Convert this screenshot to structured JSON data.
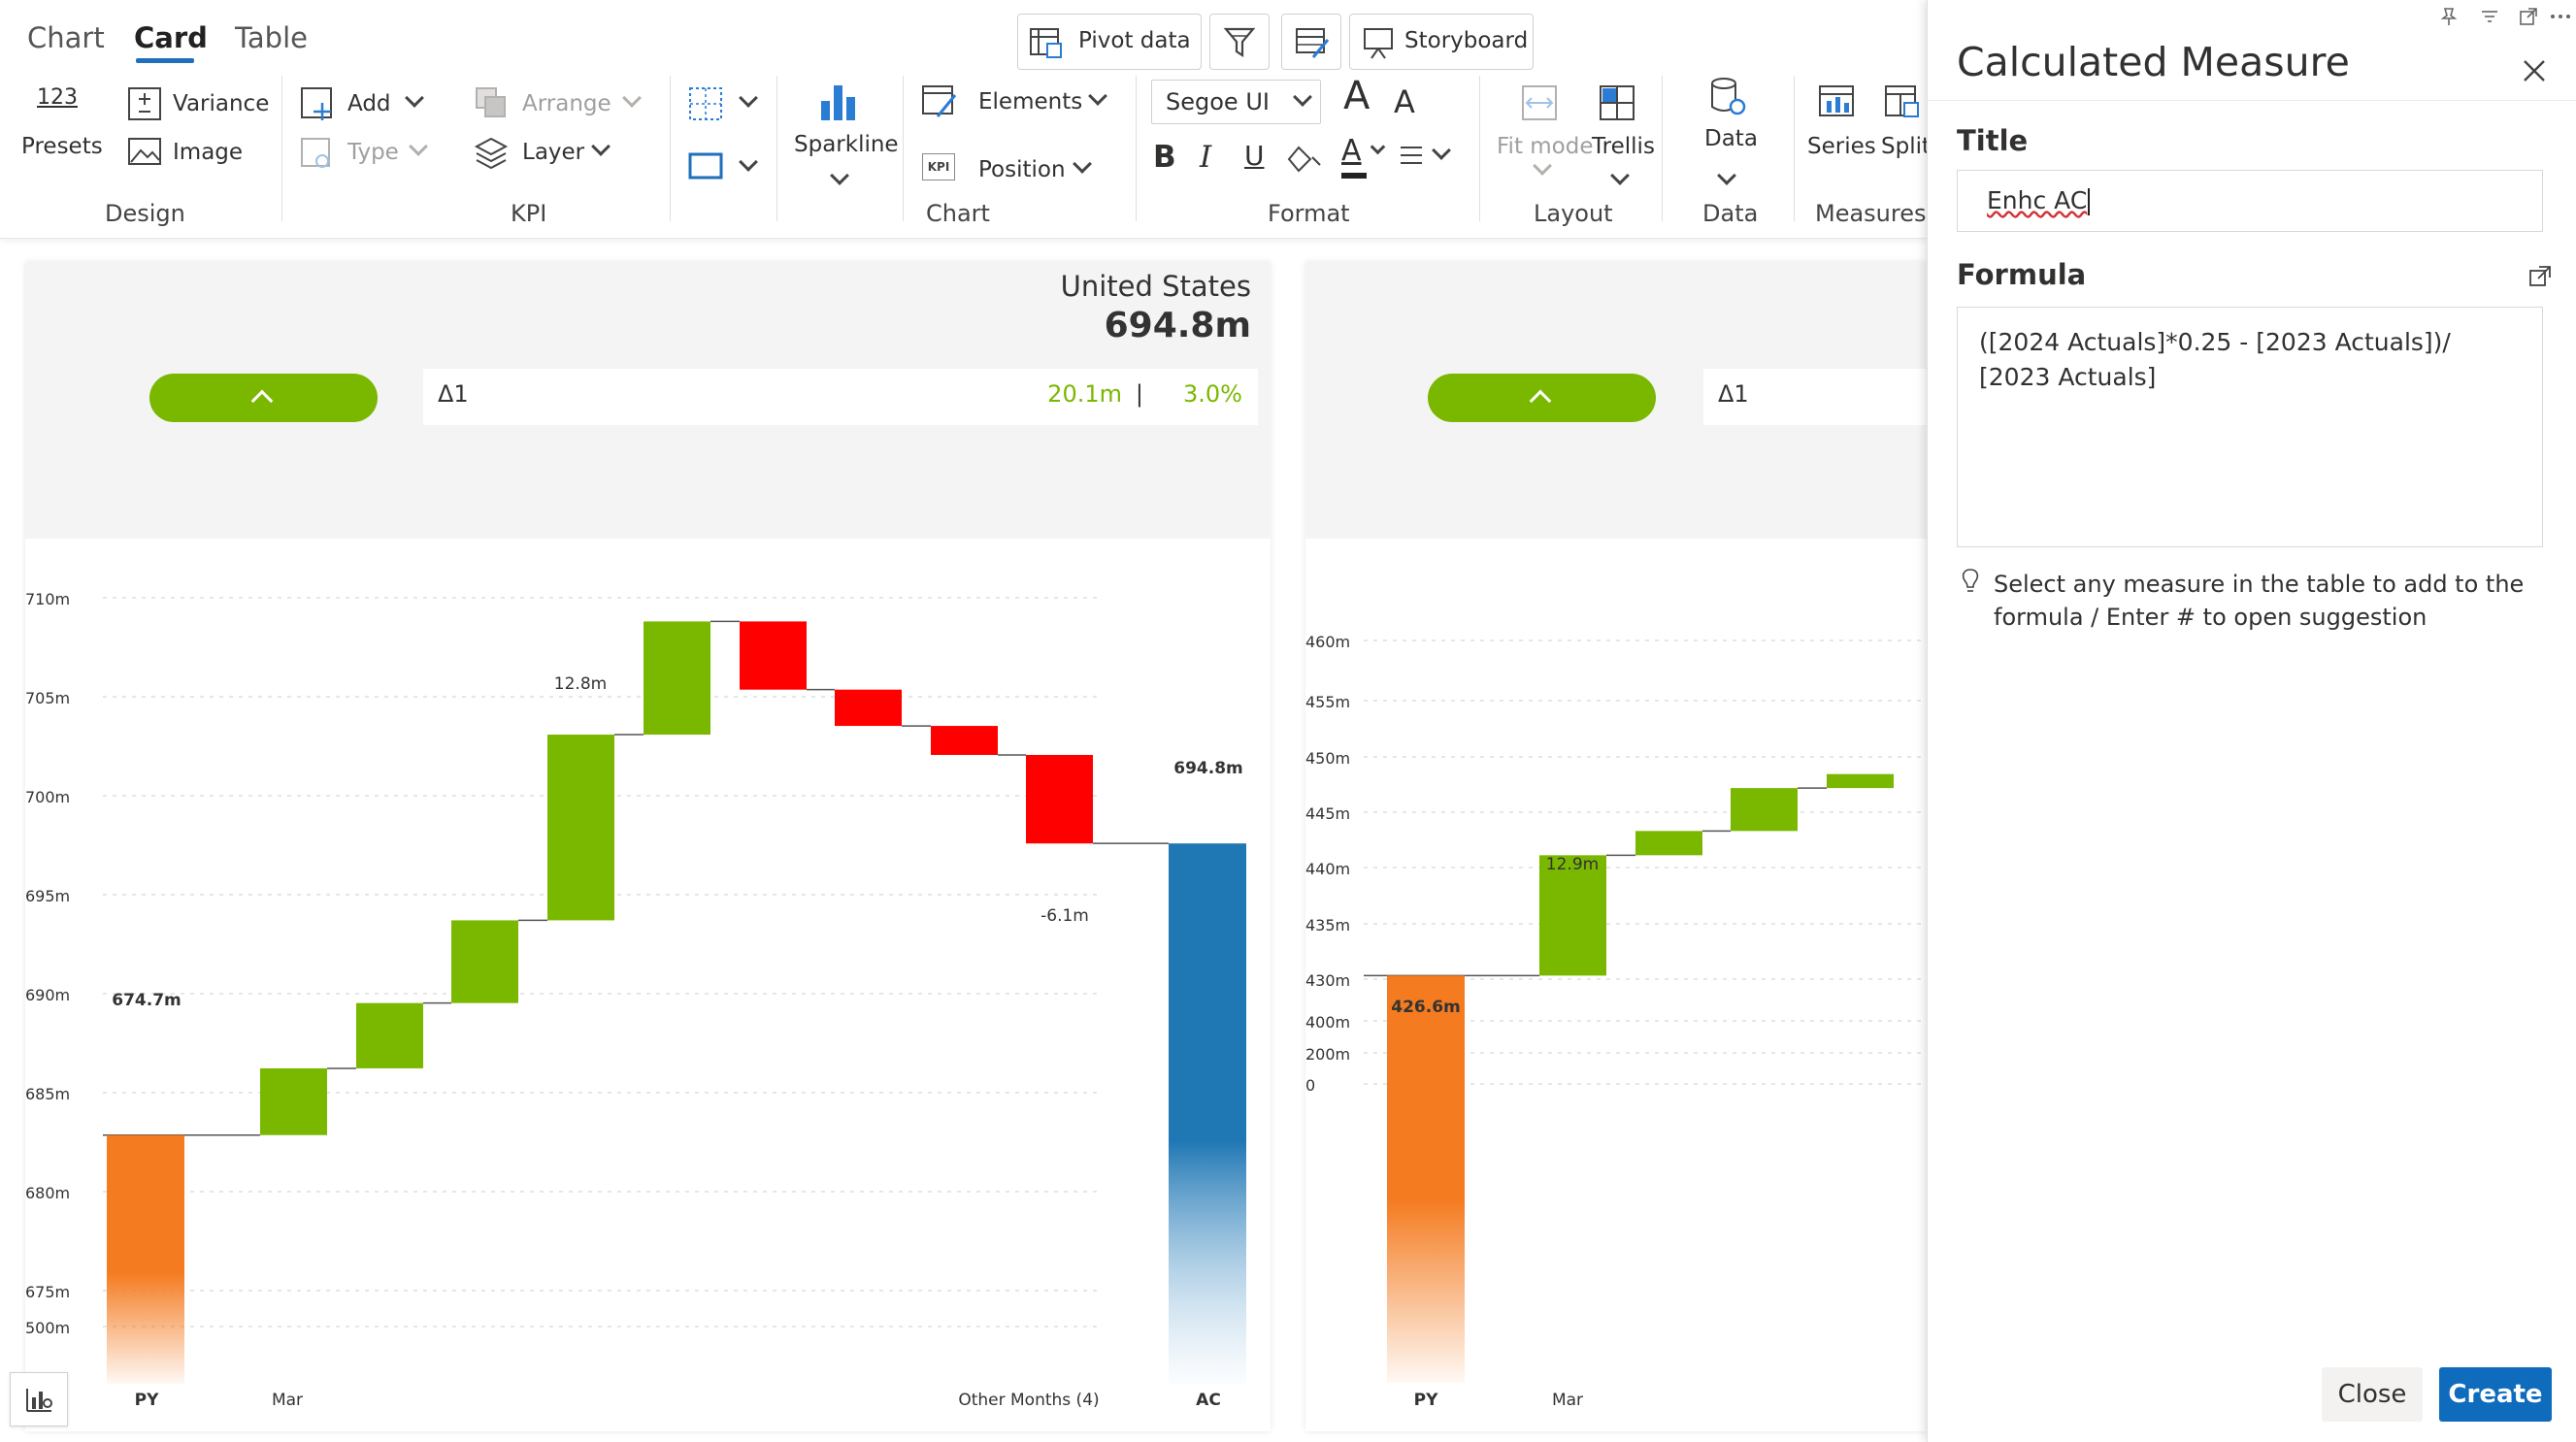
{
  "ribbon": {
    "tabs": [
      {
        "label": "Chart"
      },
      {
        "label": "Card"
      },
      {
        "label": "Table"
      }
    ],
    "top_buttons": {
      "pivot_data": "Pivot data",
      "storyboard": "Storyboard"
    },
    "design": {
      "presets_num": "123",
      "presets": "Presets",
      "variance": "Variance",
      "image": "Image",
      "group": "Design"
    },
    "kpi": {
      "add": "Add",
      "type": "Type",
      "arrange": "Arrange",
      "layer": "Layer",
      "group": "KPI"
    },
    "chart": {
      "sparkline": "Sparkline",
      "elements": "Elements",
      "position": "Position",
      "kpi_badge": "KPI",
      "group": "Chart"
    },
    "format": {
      "font": "Segoe UI",
      "bold": "B",
      "italic": "I",
      "underline": "U",
      "grow": "A",
      "shrink": "A",
      "font_color": "A",
      "group": "Format"
    },
    "layout": {
      "fit_mode": "Fit mode",
      "trellis": "Trellis",
      "group": "Layout"
    },
    "data": {
      "data": "Data",
      "group": "Data"
    },
    "measures": {
      "series": "Series",
      "split": "Split",
      "group": "Measures"
    }
  },
  "card1": {
    "country": "United States",
    "value": "694.8m",
    "delta_label": "Δ1",
    "delta_abs": "20.1m",
    "delta_sep": "|",
    "delta_pct": "3.0%"
  },
  "card2": {
    "delta_label": "Δ1"
  },
  "chart_data": [
    {
      "type": "waterfall",
      "title": "",
      "ylim": [
        670,
        712
      ],
      "y_ticks": [
        "710m",
        "705m",
        "700m",
        "695m",
        "690m",
        "685m",
        "680m",
        "675m",
        "500m"
      ],
      "x_labels": [
        "PY",
        "Mar",
        "Other Months (4)",
        "AC"
      ],
      "bars": [
        {
          "kind": "total",
          "start": 0,
          "end": 674.7,
          "color": "#f47b20"
        },
        {
          "kind": "delta",
          "start": 674.7,
          "end": 679.3,
          "color": "#7ab800"
        },
        {
          "kind": "delta",
          "start": 679.3,
          "end": 683.8,
          "color": "#7ab800"
        },
        {
          "kind": "delta",
          "start": 683.8,
          "end": 689.5,
          "color": "#7ab800"
        },
        {
          "kind": "delta",
          "start": 689.5,
          "end": 702.3,
          "color": "#7ab800"
        },
        {
          "kind": "delta",
          "start": 702.3,
          "end": 710.1,
          "color": "#7ab800"
        },
        {
          "kind": "delta",
          "start": 710.1,
          "end": 705.4,
          "color": "#ff0000"
        },
        {
          "kind": "delta",
          "start": 705.4,
          "end": 702.9,
          "color": "#ff0000"
        },
        {
          "kind": "delta",
          "start": 702.9,
          "end": 700.9,
          "color": "#ff0000"
        },
        {
          "kind": "delta",
          "start": 700.9,
          "end": 694.8,
          "color": "#ff0000"
        },
        {
          "kind": "total",
          "start": 0,
          "end": 694.8,
          "color": "#1f77b4"
        }
      ],
      "labels": [
        "674.7m",
        "12.8m",
        "-6.1m",
        "694.8m"
      ]
    },
    {
      "type": "waterfall",
      "title": "",
      "ylim": [
        423,
        462
      ],
      "y_ticks": [
        "460m",
        "455m",
        "450m",
        "445m",
        "440m",
        "435m",
        "430m",
        "400m",
        "200m",
        "0"
      ],
      "x_labels": [
        "PY",
        "Mar"
      ],
      "bars": [
        {
          "kind": "total",
          "start": 0,
          "end": 426.6,
          "color": "#f47b20"
        },
        {
          "kind": "delta",
          "start": 426.6,
          "end": 439.5,
          "color": "#7ab800"
        },
        {
          "kind": "delta",
          "start": 439.5,
          "end": 442.1,
          "color": "#7ab800"
        },
        {
          "kind": "delta",
          "start": 442.1,
          "end": 446.7,
          "color": "#7ab800"
        },
        {
          "kind": "delta",
          "start": 446.7,
          "end": 448.2,
          "color": "#7ab800"
        }
      ],
      "labels": [
        "426.6m",
        "12.9m"
      ]
    }
  ],
  "panel": {
    "title": "Calculated Measure",
    "title_label": "Title",
    "title_value": "Enhc AC",
    "formula_label": "Formula",
    "formula_value": "([2024 Actuals]*0.25 - [2023 Actuals])/ [2023 Actuals]",
    "hint": "Select any measure in the table to add to the formula / Enter # to open suggestion",
    "close_button": "Close",
    "create_button": "Create"
  },
  "colors": {
    "accent": "#0f6cbd",
    "positive": "#7ab800",
    "negative": "#ff0000",
    "py": "#f47b20",
    "ac": "#1f77b4"
  }
}
